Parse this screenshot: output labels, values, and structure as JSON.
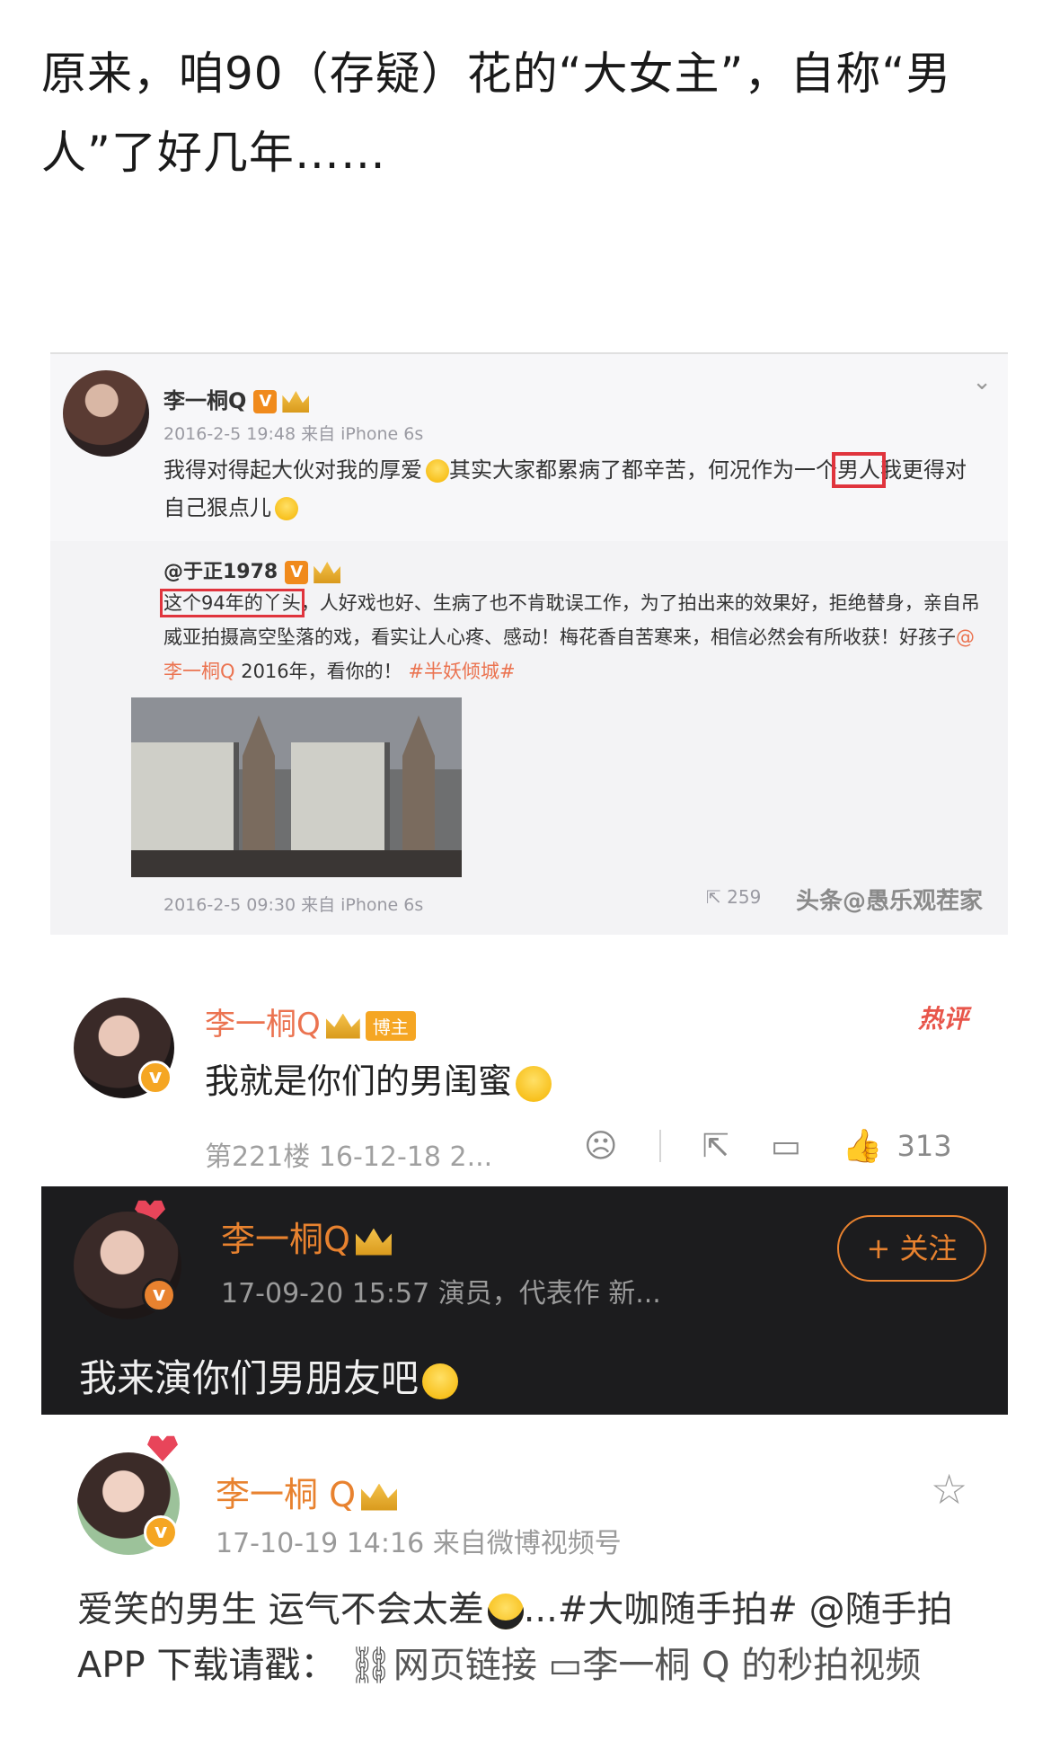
{
  "headline": "原来，咱90（存疑）花的“大女主”，自称“男人”了好几年……",
  "post1": {
    "username": "李一桐Q",
    "v_badge": "V",
    "time": "2016-2-5 19:48 来自 iPhone 6s",
    "text_before": "我得对得起大伙对我的厚爱",
    "text_mid": "其实大家都累病了都辛苦，何况作为一个",
    "highlight": "男人",
    "text_after": "我更得对自己狠点儿",
    "repost_user": "@于正1978",
    "repost_highlight": "这个94年的丫头",
    "repost_text": "人好戏也好、生病了也不肯耽误工作，为了拍出来的效果好，拒绝替身，亲自吊威亚拍摄高空坠落的戏，看实让人心疼、感动！梅花香自苦寒来，相信必然会有所收获！好孩子",
    "repost_mention": "@李一桐Q",
    "repost_tail": " 2016年，看你的！",
    "repost_tag": "#半妖倾城#",
    "repost_time": "2016-2-5 09:30 来自 iPhone 6s",
    "repost_count": "259",
    "watermark": "头条@愚乐观茬家"
  },
  "comment1": {
    "username": "李一桐Q",
    "badge": "博主",
    "text": "我就是你们的男闺蜜",
    "hot_label": "热评",
    "meta": "第221楼 16-12-18 2...",
    "like_count": "313"
  },
  "comment2": {
    "username": "李一桐Q",
    "meta": "17-09-20 15:57  演员，代表作 新...",
    "follow_label": "+ 关注",
    "text": "我来演你们男朋友吧"
  },
  "post2": {
    "username": "李一桐 Q",
    "meta": "17-10-19 14:16  来自微博视频号",
    "text": "爱笑的男生 运气不会太差",
    "text_tail": "...#大咖随手拍# @随手拍 APP 下载请戳：",
    "link1": "网页链接",
    "link2": "李一桐 Q 的秒拍视频"
  }
}
